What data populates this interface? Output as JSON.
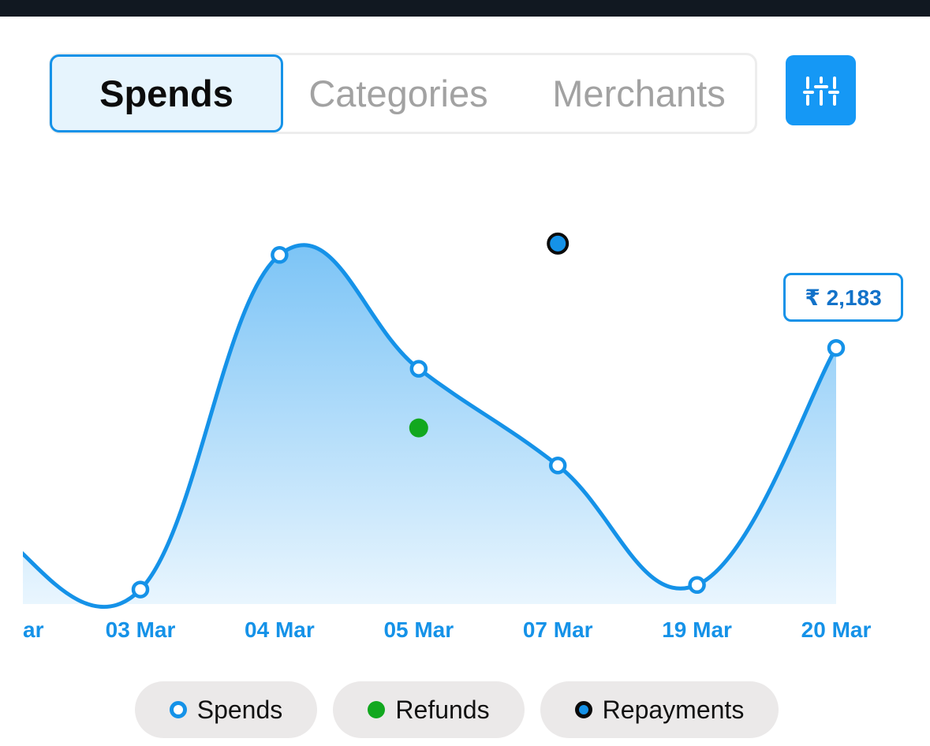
{
  "tabs": {
    "spends": "Spends",
    "categories": "Categories",
    "merchants": "Merchants",
    "active": "Spends"
  },
  "filter_button": {
    "icon": "sliders-icon"
  },
  "tooltip": {
    "text": "₹ 2,183"
  },
  "legend": {
    "spends": "Spends",
    "refunds": "Refunds",
    "repayments": "Repayments"
  },
  "colors": {
    "accent": "#1592E8",
    "refunds": "#12A81F",
    "repayments_border": "#0B0B0B",
    "area_top": "#7CC4F6",
    "area_bottom": "#EAF6FE"
  },
  "chart_data": {
    "type": "area",
    "x_partial_first": "ar",
    "categories": [
      "03 Mar",
      "04 Mar",
      "05 Mar",
      "07 Mar",
      "19 Mar",
      "20 Mar"
    ],
    "series": [
      {
        "name": "Spends",
        "values": [
          60,
          3000,
          2000,
          1150,
          100,
          2183
        ]
      },
      {
        "name": "Refunds",
        "points": [
          {
            "x": "05 Mar",
            "y": 1480
          }
        ]
      },
      {
        "name": "Repayments",
        "points": [
          {
            "x": "07 Mar",
            "y": 3100
          }
        ]
      }
    ],
    "highlighted": {
      "x": "20 Mar",
      "value": 2183
    },
    "ylim": [
      -130,
      3300
    ],
    "grid": false,
    "legend_position": "bottom"
  }
}
